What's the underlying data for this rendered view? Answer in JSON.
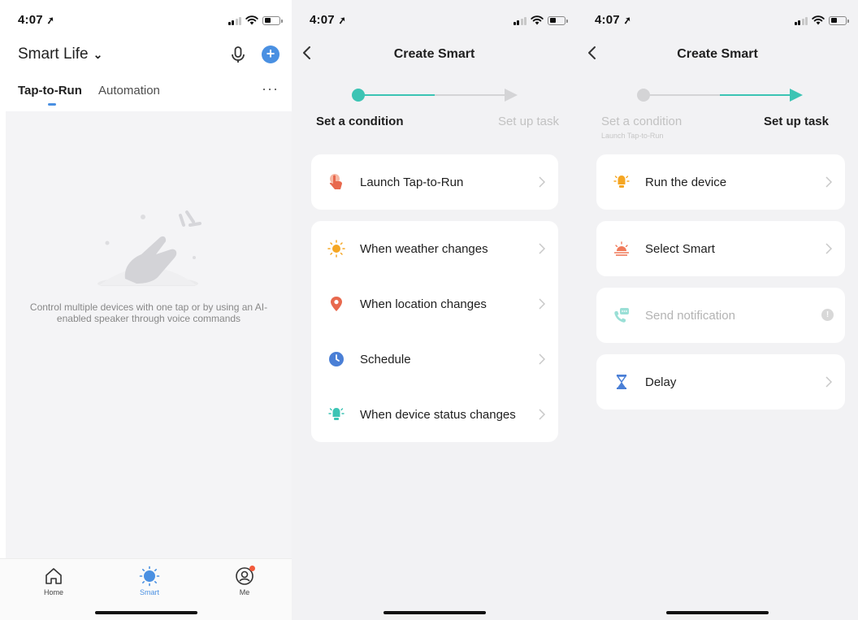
{
  "screens": [
    {
      "status": {
        "time": "4:07",
        "location_arrow": "➚"
      },
      "header": {
        "title": "Smart Life",
        "caret": "⌄",
        "mic_icon": "microphone-icon",
        "add_icon": "plus-icon",
        "add_symbol": "+"
      },
      "tabs": [
        {
          "label": "Tap-to-Run",
          "active": true
        },
        {
          "label": "Automation",
          "active": false
        }
      ],
      "more_label": "···",
      "empty_state": {
        "text": "Control multiple devices with one tap or by using an AI-enabled speaker through voice commands"
      },
      "bottom_nav": [
        {
          "label": "Home",
          "icon": "home-icon"
        },
        {
          "label": "Smart",
          "icon": "smart-sun-icon",
          "active": true
        },
        {
          "label": "Me",
          "icon": "profile-icon"
        }
      ]
    },
    {
      "status": {
        "time": "4:07",
        "location_arrow": "➚"
      },
      "nav": {
        "title": "Create Smart"
      },
      "steps": {
        "left": "Set a condition",
        "right": "Set up task"
      },
      "groups": [
        [
          {
            "label": "Launch Tap-to-Run",
            "icon": "tap-hand-icon"
          }
        ],
        [
          {
            "label": "When weather changes",
            "icon": "sun-icon"
          },
          {
            "label": "When location changes",
            "icon": "location-pin-icon"
          },
          {
            "label": "Schedule",
            "icon": "clock-icon"
          },
          {
            "label": "When device status changes",
            "icon": "device-status-icon"
          }
        ]
      ]
    },
    {
      "status": {
        "time": "4:07",
        "location_arrow": "➚"
      },
      "nav": {
        "title": "Create Smart"
      },
      "steps": {
        "left": "Set a condition",
        "left_sub": "Launch Tap-to-Run",
        "right": "Set up task"
      },
      "items": [
        {
          "label": "Run the device",
          "icon": "device-bulb-icon"
        },
        {
          "label": "Select Smart",
          "icon": "sunrise-icon"
        },
        {
          "label": "Send notification",
          "icon": "notification-phone-icon",
          "disabled": true,
          "badge": "!"
        },
        {
          "label": "Delay",
          "icon": "hourglass-icon"
        }
      ]
    }
  ],
  "colors": {
    "accent_blue": "#4a90e2",
    "accent_teal": "#3cc4b4",
    "background": "#f2f2f4",
    "muted_text": "#888888"
  }
}
